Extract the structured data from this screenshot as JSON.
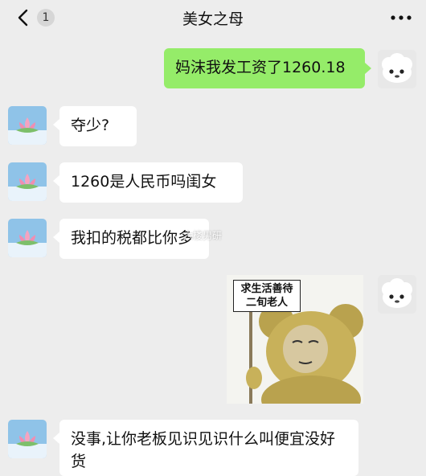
{
  "header": {
    "back_count": "1",
    "title": "美女之母"
  },
  "messages": [
    {
      "side": "right",
      "text": "妈沫我发工资了1260.18"
    },
    {
      "side": "left",
      "text": "夺少?"
    },
    {
      "side": "left",
      "text": "1260是人民币吗闺女"
    },
    {
      "side": "left",
      "text": "我扣的税都比你多"
    },
    {
      "side": "right",
      "type": "sticker",
      "caption": "求生活善待\n二旬老人"
    },
    {
      "side": "left",
      "text": "没事,让你老板见识见识什么叫便宜没好货"
    }
  ],
  "watermark": "六楼男研",
  "icons": {
    "back": "chevron-left-icon",
    "more": "more-horizontal-icon",
    "self_avatar": "sheep-avatar-icon",
    "mom_avatar": "lotus-avatar-icon"
  }
}
